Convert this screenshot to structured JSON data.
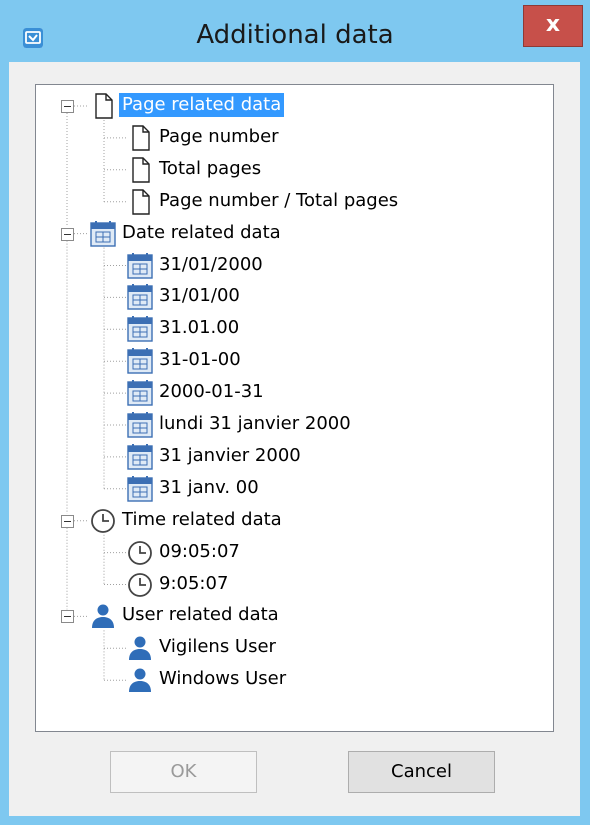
{
  "window": {
    "title": "Additional data",
    "close_label": "x",
    "accent": "#7ec8f0",
    "close_color": "#c7504a"
  },
  "tree": {
    "groups": [
      {
        "label": "Page related data",
        "icon": "page-icon",
        "selected": true,
        "children": [
          "Page number",
          "Total pages",
          "Page number / Total pages"
        ]
      },
      {
        "label": "Date related data",
        "icon": "calendar-icon",
        "selected": false,
        "children": [
          "31/01/2000",
          "31/01/00",
          "31.01.00",
          "31-01-00",
          "2000-01-31",
          "lundi 31 janvier 2000",
          "31 janvier 2000",
          "31 janv. 00"
        ]
      },
      {
        "label": "Time related data",
        "icon": "clock-icon",
        "selected": false,
        "children": [
          "09:05:07",
          "9:05:07"
        ]
      },
      {
        "label": "User related data",
        "icon": "user-icon",
        "selected": false,
        "children": [
          "Vigilens User",
          "Windows User"
        ]
      }
    ]
  },
  "buttons": {
    "ok_label": "OK",
    "cancel_label": "Cancel"
  }
}
